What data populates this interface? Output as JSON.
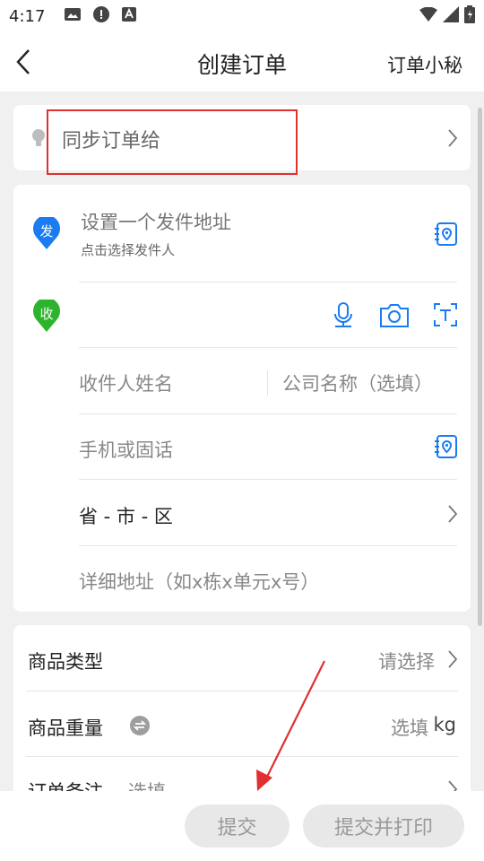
{
  "status_bar": {
    "time": "4:17"
  },
  "header": {
    "title": "创建订单",
    "right_link": "订单小秘"
  },
  "sync": {
    "label": "同步订单给"
  },
  "sender": {
    "badge": "发",
    "title": "设置一个发件地址",
    "subtitle": "点击选择发件人"
  },
  "receiver": {
    "badge": "收",
    "name_placeholder": "收件人姓名",
    "company_placeholder": "公司名称（选填）",
    "phone_placeholder": "手机或固话",
    "region": "省 - 市 - 区",
    "address_placeholder": "详细地址（如x栋x单元x号）"
  },
  "goods": {
    "type_label": "商品类型",
    "type_value": "请选择",
    "weight_label": "商品重量",
    "weight_value": "选填",
    "weight_unit": "kg",
    "remark_label": "订单备注",
    "remark_value": "选填"
  },
  "actions": {
    "submit": "提交",
    "submit_print": "提交并打印"
  },
  "colors": {
    "accent_blue": "#1a7cf0",
    "green": "#2cb52c",
    "highlight_red": "#e03030"
  }
}
